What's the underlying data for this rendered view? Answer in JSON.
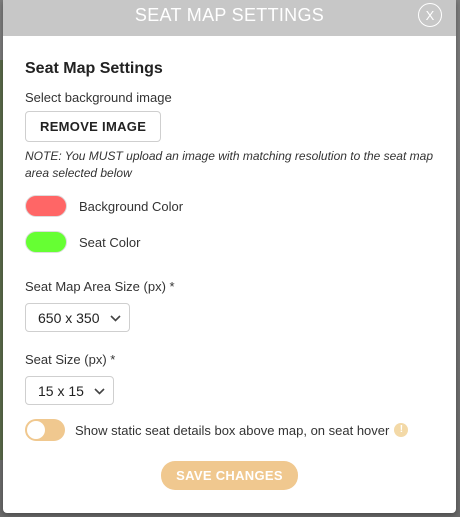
{
  "header": {
    "title": "SEAT MAP SETTINGS",
    "close_label": "X"
  },
  "body": {
    "section_title": "Seat Map Settings",
    "background_image_label": "Select background image",
    "remove_image_label": "REMOVE IMAGE",
    "note": "NOTE: You MUST upload an image with matching resolution to the seat map area selected below",
    "background_color": {
      "label": "Background Color",
      "value": "#ff6666"
    },
    "seat_color": {
      "label": "Seat Color",
      "value": "#66ff33"
    },
    "area_size": {
      "label": "Seat Map Area Size (px) *",
      "selected": "650 x 350"
    },
    "seat_size": {
      "label": "Seat Size (px) *",
      "selected": "15 x 15"
    },
    "hover_toggle": {
      "label": "Show static seat details box above map, on seat hover",
      "on": false
    },
    "save_label": "SAVE CHANGES"
  },
  "icons": {
    "close": "close-icon",
    "chevron": "chevron-down-icon",
    "info": "info-icon"
  },
  "colors": {
    "header_bg": "#c7c7c7",
    "accent": "#f0c88f"
  }
}
